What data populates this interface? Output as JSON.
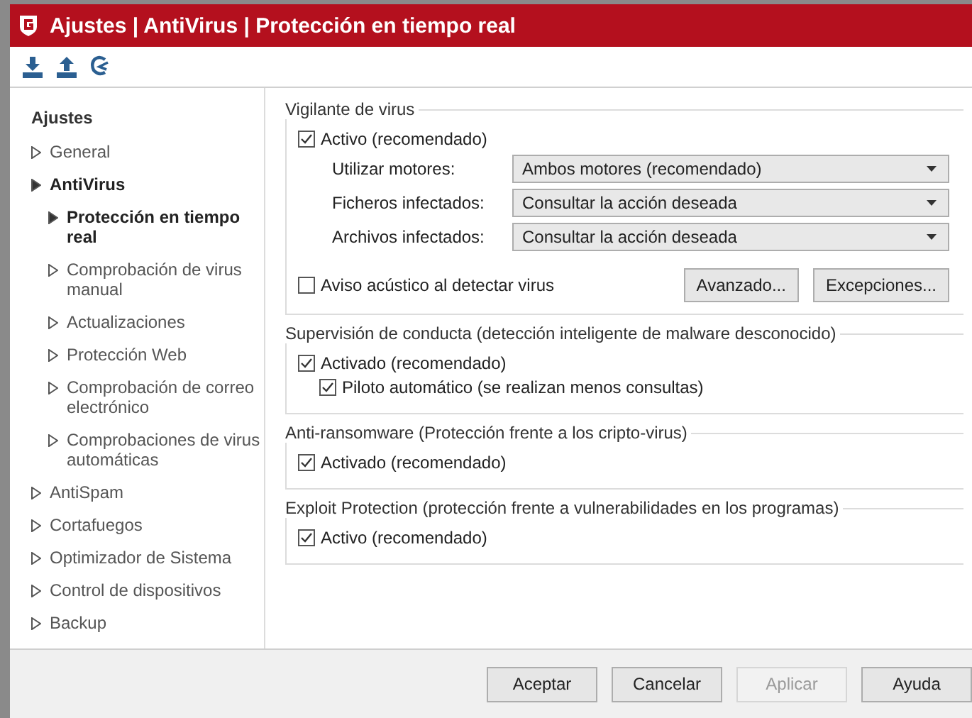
{
  "window": {
    "title": "Ajustes | AntiVirus | Protección en tiempo real"
  },
  "sidebar": {
    "title": "Ajustes",
    "items": [
      {
        "label": "General",
        "expanded": false
      },
      {
        "label": "AntiVirus",
        "expanded": true,
        "children": [
          {
            "label": "Protección en tiempo real",
            "selected": true
          },
          {
            "label": "Comprobación de virus manual",
            "selected": false
          },
          {
            "label": "Actualizaciones",
            "selected": false
          },
          {
            "label": "Protección Web",
            "selected": false
          },
          {
            "label": "Comprobación de correo electrónico",
            "selected": false
          },
          {
            "label": "Comprobaciones de virus automáticas",
            "selected": false
          }
        ]
      },
      {
        "label": "AntiSpam",
        "expanded": false
      },
      {
        "label": "Cortafuegos",
        "expanded": false
      },
      {
        "label": "Optimizador de Sistema",
        "expanded": false
      },
      {
        "label": "Control de dispositivos",
        "expanded": false
      },
      {
        "label": "Backup",
        "expanded": false
      }
    ]
  },
  "groups": [
    {
      "title": "Vigilante de virus",
      "items": [
        {
          "kind": "checkbox",
          "label": "Activo (recomendado)",
          "checked": true
        },
        {
          "kind": "dropdown",
          "label": "Utilizar motores:",
          "value": "Ambos motores (recomendado)"
        },
        {
          "kind": "dropdown",
          "label": "Ficheros infectados:",
          "value": "Consultar la acción deseada"
        },
        {
          "kind": "dropdown",
          "label": "Archivos infectados:",
          "value": "Consultar la acción deseada"
        },
        {
          "kind": "actions",
          "label": "Aviso acústico al detectar virus",
          "checked": false,
          "buttons": [
            "Avanzado...",
            "Excepciones..."
          ]
        }
      ]
    },
    {
      "title": "Supervisión de conducta (detección inteligente de malware desconocido)",
      "items": [
        {
          "kind": "checkbox",
          "label": "Activado (recomendado)",
          "checked": true,
          "children": [
            {
              "kind": "checkbox",
              "label": "Piloto automático (se realizan menos consultas)",
              "checked": true
            }
          ]
        }
      ]
    },
    {
      "title": "Anti-ransomware (Protección frente a los cripto-virus)",
      "items": [
        {
          "kind": "checkbox",
          "label": "Activado (recomendado)",
          "checked": true
        }
      ]
    },
    {
      "title": "Exploit Protection (protección frente a vulnerabilidades en los programas)",
      "items": [
        {
          "kind": "checkbox",
          "label": "Activo (recomendado)",
          "checked": true
        }
      ]
    }
  ],
  "footer_buttons": [
    {
      "label": "Aceptar",
      "disabled": false
    },
    {
      "label": "Cancelar",
      "disabled": false
    },
    {
      "label": "Aplicar",
      "disabled": true
    },
    {
      "label": "Ayuda",
      "disabled": false
    }
  ]
}
